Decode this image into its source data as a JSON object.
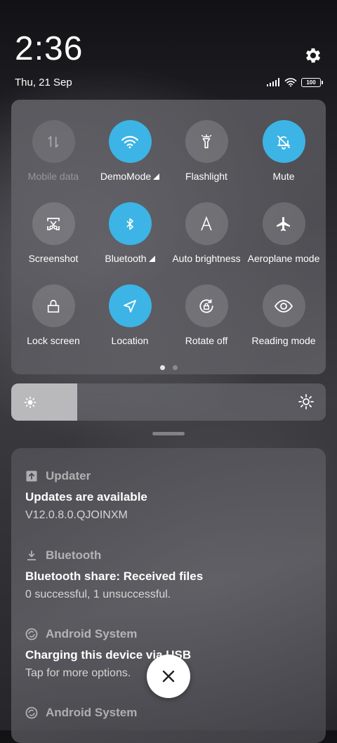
{
  "status": {
    "time": "2:36",
    "date": "Thu, 21 Sep",
    "battery": "100",
    "icons": [
      "signal-icon",
      "wifi-icon",
      "battery-icon",
      "gear-icon"
    ]
  },
  "quick_settings": {
    "accent": "#3cb4e5",
    "tiles": [
      {
        "label": "Mobile data",
        "icon": "mobile-data-icon",
        "active": false,
        "disabled": true
      },
      {
        "label": "DemoMode",
        "icon": "wifi-icon",
        "active": true,
        "has_arrow": true
      },
      {
        "label": "Flashlight",
        "icon": "flashlight-icon",
        "active": false
      },
      {
        "label": "Mute",
        "icon": "bell-off-icon",
        "active": true
      },
      {
        "label": "Screenshot",
        "icon": "screenshot-icon",
        "active": false
      },
      {
        "label": "Bluetooth",
        "icon": "bluetooth-icon",
        "active": true,
        "has_arrow": true
      },
      {
        "label": "Auto brightness",
        "icon": "auto-brightness-icon",
        "active": false
      },
      {
        "label": "Aeroplane mode",
        "icon": "airplane-icon",
        "active": false
      },
      {
        "label": "Lock screen",
        "icon": "lock-icon",
        "active": false
      },
      {
        "label": "Location",
        "icon": "location-icon",
        "active": true
      },
      {
        "label": "Rotate off",
        "icon": "rotate-lock-icon",
        "active": false
      },
      {
        "label": "Reading mode",
        "icon": "eye-icon",
        "active": false
      }
    ],
    "pages": 2,
    "current_page": 1
  },
  "brightness": {
    "level_fraction": 0.21
  },
  "notifications": [
    {
      "app": "Updater",
      "icon": "upload-icon",
      "title": "Updates are available",
      "text": "V12.0.8.0.QJOINXM"
    },
    {
      "app": "Bluetooth",
      "icon": "download-icon",
      "title": "Bluetooth share: Received files",
      "text": "0 successful, 1 unsuccessful."
    },
    {
      "app": "Android System",
      "icon": "android-system-icon",
      "title": "Charging this device via USB",
      "text": "Tap for more options."
    },
    {
      "app": "Android System",
      "icon": "android-system-icon",
      "title": "",
      "text": ""
    }
  ],
  "close_button": {
    "icon": "close-icon"
  }
}
